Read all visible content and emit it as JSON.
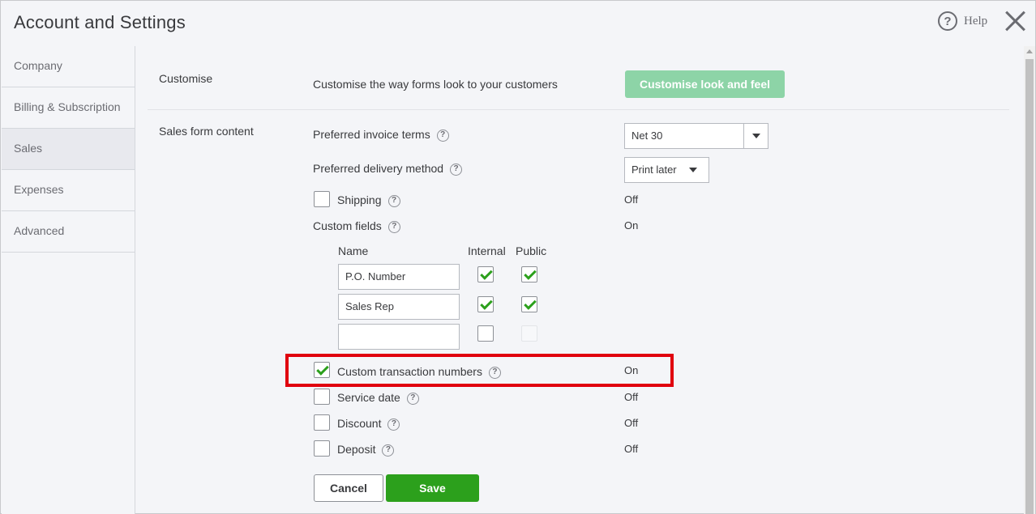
{
  "header": {
    "title": "Account and Settings",
    "help_label": "Help"
  },
  "sidebar": {
    "items": [
      {
        "label": "Company"
      },
      {
        "label": "Billing & Subscription"
      },
      {
        "label": "Sales"
      },
      {
        "label": "Expenses"
      },
      {
        "label": "Advanced"
      }
    ],
    "active": "Sales"
  },
  "customise": {
    "section_label": "Customise",
    "description": "Customise the way forms look to your customers",
    "button_label": "Customise look and feel"
  },
  "sales_form": {
    "section_label": "Sales form content",
    "invoice_terms_label": "Preferred invoice terms",
    "invoice_terms_value": "Net 30",
    "delivery_method_label": "Preferred delivery method",
    "delivery_method_value": "Print later",
    "shipping_label": "Shipping",
    "shipping_status": "Off",
    "custom_fields_label": "Custom fields",
    "custom_fields_status": "On",
    "custom_fields_table": {
      "headers": {
        "name": "Name",
        "internal": "Internal",
        "public": "Public"
      },
      "rows": [
        {
          "name": "P.O. Number",
          "internal": true,
          "public": true
        },
        {
          "name": "Sales Rep",
          "internal": true,
          "public": true
        },
        {
          "name": "",
          "internal": false,
          "public": false
        }
      ]
    },
    "custom_txn_label": "Custom transaction numbers",
    "custom_txn_status": "On",
    "service_date_label": "Service date",
    "service_date_status": "Off",
    "discount_label": "Discount",
    "discount_status": "Off",
    "deposit_label": "Deposit",
    "deposit_status": "Off"
  },
  "actions": {
    "cancel_label": "Cancel",
    "save_label": "Save"
  },
  "colors": {
    "accent_green": "#2ca01c",
    "light_green": "#8dd4a7",
    "highlight_red": "#e0000e"
  }
}
